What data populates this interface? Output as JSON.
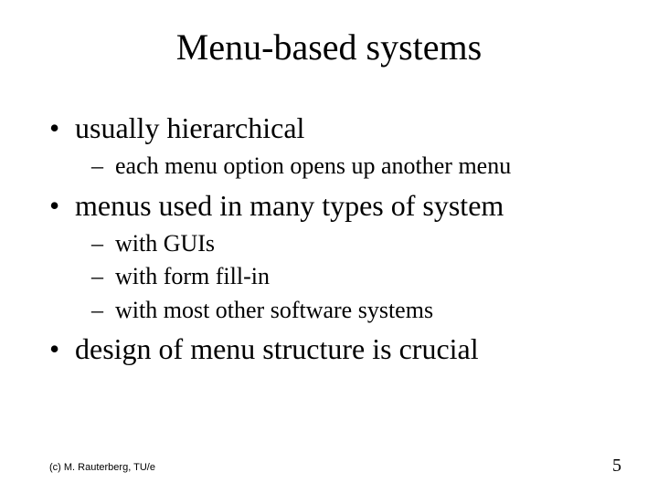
{
  "title": "Menu-based systems",
  "bullets": {
    "b1_0": "usually hierarchical",
    "b2_0": "each menu option opens up another menu",
    "b1_1": "menus used in many types of system",
    "b2_1": "with GUIs",
    "b2_2": "with form fill-in",
    "b2_3": "with most other software systems",
    "b1_2": "design of menu structure is crucial"
  },
  "footer": {
    "copyright": "(c) M. Rauterberg, TU/e",
    "page_number": "5"
  }
}
